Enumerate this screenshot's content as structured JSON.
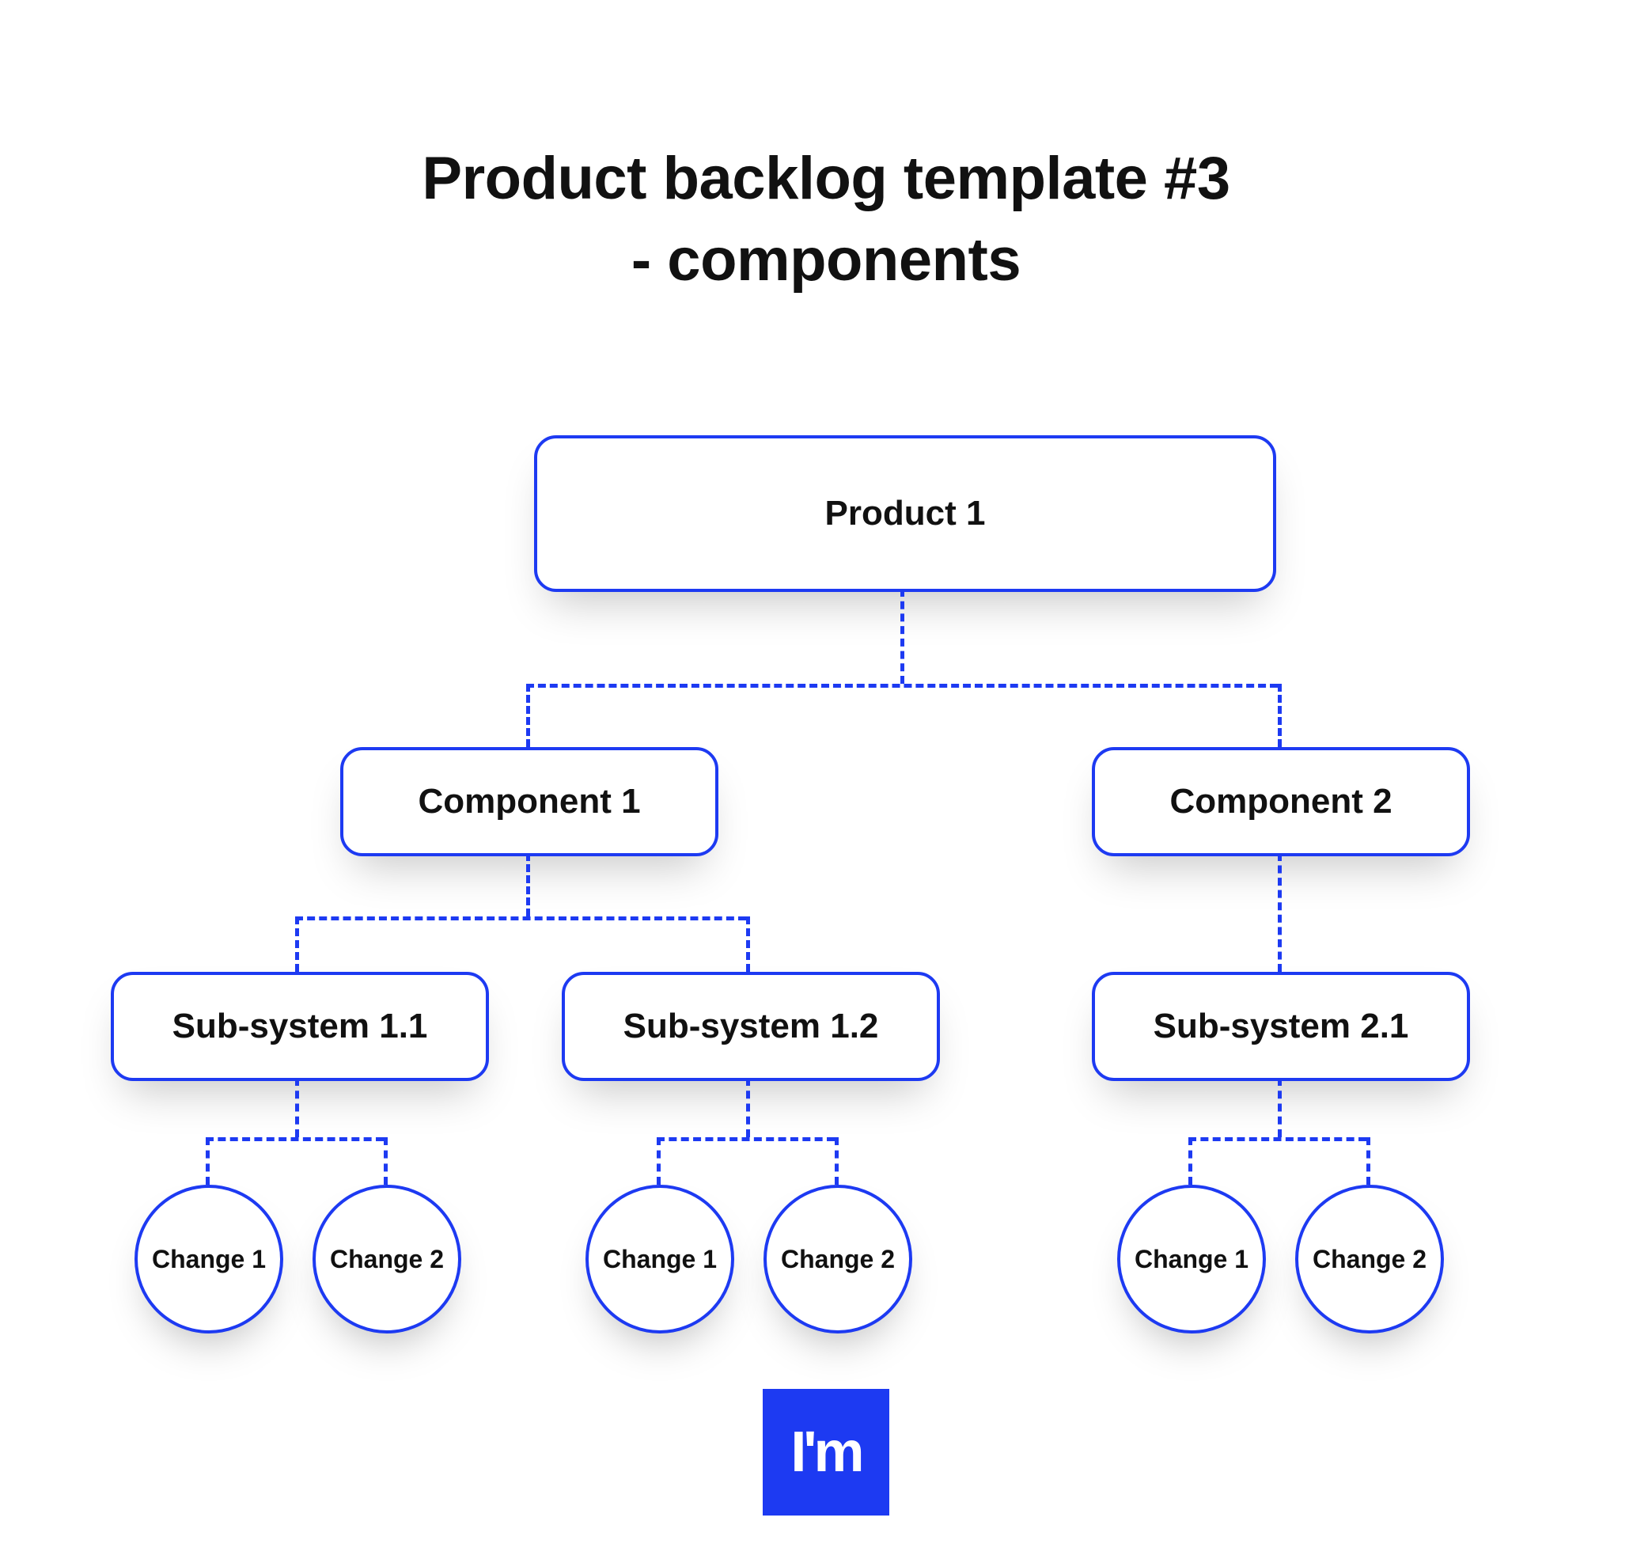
{
  "title_line1": "Product backlog template #3",
  "title_line2": "- components",
  "colors": {
    "accent": "#1d3af2",
    "text": "#111111"
  },
  "tree": {
    "root": "Product 1",
    "components": [
      {
        "label": "Component 1",
        "subsystems": [
          {
            "label": "Sub-system 1.1",
            "changes": [
              "Change 1",
              "Change 2"
            ]
          },
          {
            "label": "Sub-system 1.2",
            "changes": [
              "Change 1",
              "Change 2"
            ]
          }
        ]
      },
      {
        "label": "Component 2",
        "subsystems": [
          {
            "label": "Sub-system 2.1",
            "changes": [
              "Change 1",
              "Change 2"
            ]
          }
        ]
      }
    ]
  },
  "logo": {
    "text": "I'm"
  }
}
